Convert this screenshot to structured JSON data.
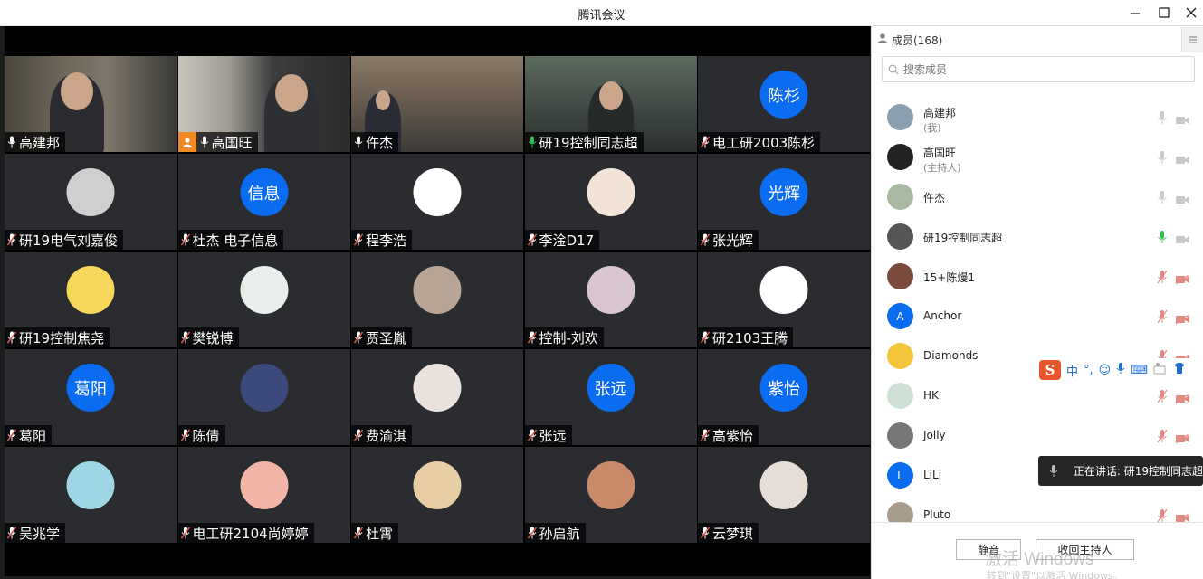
{
  "window": {
    "title": "腾讯会议"
  },
  "tiles": [
    {
      "name": "高建邦",
      "mic": "on",
      "type": "cam1"
    },
    {
      "name": "高国旺",
      "mic": "on",
      "type": "cam2",
      "host": true
    },
    {
      "name": "仵杰",
      "mic": "on",
      "type": "cam3"
    },
    {
      "name": "研19控制同志超",
      "mic": "speaking",
      "type": "cam4"
    },
    {
      "name": "电工研2003陈杉",
      "mic": "muted",
      "avatar_text": "陈杉"
    },
    {
      "name": "研19电气刘嘉俊",
      "mic": "muted",
      "avatar_img": "#cfcfcf"
    },
    {
      "name": "杜杰 电子信息",
      "mic": "muted",
      "avatar_text": "信息"
    },
    {
      "name": "程李浩",
      "mic": "muted",
      "avatar_img": "#ffffff"
    },
    {
      "name": "李淦D17",
      "mic": "muted",
      "avatar_img": "#f2e3d7"
    },
    {
      "name": "张光辉",
      "mic": "muted",
      "avatar_text": "光辉"
    },
    {
      "name": "研19控制焦尧",
      "mic": "muted",
      "avatar_img": "#f7d75b"
    },
    {
      "name": "樊锐博",
      "mic": "muted",
      "avatar_img": "#e8eeea"
    },
    {
      "name": "贾圣胤",
      "mic": "muted",
      "avatar_img": "#b9a498"
    },
    {
      "name": "控制-刘欢",
      "mic": "muted",
      "avatar_img": "#d9c5cf"
    },
    {
      "name": "研2103王腾",
      "mic": "muted",
      "avatar_img": "#ffffff"
    },
    {
      "name": "葛阳",
      "mic": "muted",
      "avatar_text": "葛阳"
    },
    {
      "name": "陈倩",
      "mic": "muted",
      "avatar_img": "#3b4a7a"
    },
    {
      "name": "费渝淇",
      "mic": "muted",
      "avatar_img": "#e9e2dd"
    },
    {
      "name": "张远",
      "mic": "muted",
      "avatar_text": "张远"
    },
    {
      "name": "高紫怡",
      "mic": "muted",
      "avatar_text": "紫怡"
    },
    {
      "name": "吴兆学",
      "mic": "muted",
      "avatar_img": "#9fd6e6"
    },
    {
      "name": "电工研2104尚婷婷",
      "mic": "muted",
      "avatar_img": "#f3b6a6"
    },
    {
      "name": "杜霄",
      "mic": "muted",
      "avatar_img": "#e8cda4"
    },
    {
      "name": "孙启航",
      "mic": "muted",
      "avatar_img": "#c98a6a"
    },
    {
      "name": "云梦琪",
      "mic": "muted",
      "avatar_img": "#e5ddd6"
    }
  ],
  "panel": {
    "title": "成员(168)",
    "search_placeholder": "搜索成员",
    "members": [
      {
        "name": "高建邦",
        "sub": "(我)",
        "mic": "on",
        "avatar": "#8aa0b0"
      },
      {
        "name": "高国旺",
        "sub": "(主持人)",
        "mic": "on",
        "avatar": "#222222"
      },
      {
        "name": "仵杰",
        "sub": "",
        "mic": "on",
        "avatar": "#a9b8a2"
      },
      {
        "name": "研19控制同志超",
        "sub": "",
        "mic": "speaking",
        "avatar": "#555555"
      },
      {
        "name": "15+陈熳1",
        "sub": "",
        "mic": "muted",
        "avatar": "#7a4a3a"
      },
      {
        "name": "Anchor",
        "sub": "",
        "mic": "muted",
        "avatar_letter": "A"
      },
      {
        "name": "Diamonds",
        "sub": "",
        "mic": "muted",
        "avatar": "#f3c53a"
      },
      {
        "name": "HK",
        "sub": "",
        "mic": "muted",
        "avatar": "#cfe0d6"
      },
      {
        "name": "Jolly",
        "sub": "",
        "mic": "muted",
        "avatar": "#777777"
      },
      {
        "name": "LiLi",
        "sub": "",
        "mic": "muted",
        "avatar_letter": "L"
      },
      {
        "name": "Pluto",
        "sub": "",
        "mic": "muted",
        "avatar": "#a89c8c"
      }
    ],
    "mute_button": "静音",
    "reclaim_host_button": "收回主持人"
  },
  "ime": {
    "items": [
      "中",
      "°,",
      "☺",
      "🎤",
      "⌨"
    ]
  },
  "speaking_tip": "正在讲话: 研19控制同志超",
  "watermark": {
    "line1": "激活 Windows",
    "line2": "转到\"设置\"以激活 Windows。"
  },
  "colors": {
    "accent": "#0a6cf0",
    "speaking": "#2fbf4f",
    "muted": "#e0524a",
    "host": "#f08a24"
  }
}
